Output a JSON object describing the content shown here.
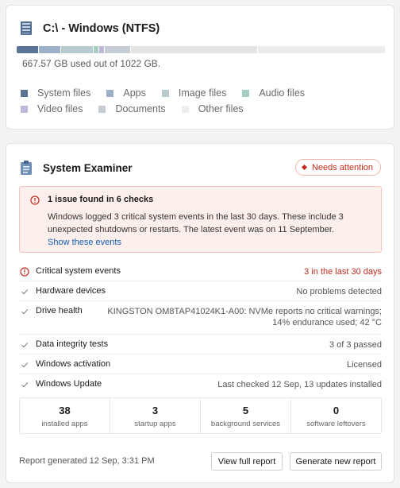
{
  "drive": {
    "title": "C:\\ - Windows (NTFS)",
    "usage_text": "667.57 GB used out of 1022 GB.",
    "used_fraction": 0.653,
    "segments": [
      {
        "name": "System files",
        "fraction": 0.06,
        "color": "#5b7396"
      },
      {
        "name": "Apps",
        "fraction": 0.06,
        "color": "#9cb0c9"
      },
      {
        "name": "Image files",
        "fraction": 0.09,
        "color": "#b7cad0"
      },
      {
        "name": "Audio files",
        "fraction": 0.015,
        "color": "#a5cfc1"
      },
      {
        "name": "Video files",
        "fraction": 0.015,
        "color": "#c0b8d9"
      },
      {
        "name": "Documents",
        "fraction": 0.07,
        "color": "#c6ccd4"
      },
      {
        "name": "Other files",
        "fraction": 0.345,
        "color": "#e4e4e4"
      }
    ],
    "legend": {
      "system": "System files",
      "apps": "Apps",
      "image": "Image files",
      "audio": "Audio files",
      "video": "Video files",
      "documents": "Documents",
      "other": "Other files"
    }
  },
  "examiner": {
    "title": "System Examiner",
    "badge": "Needs attention",
    "alert": {
      "title": "1 issue found in 6 checks",
      "body": "Windows logged 3 critical system events in the last 30 days. These include 3 unexpected shutdowns or restarts. The latest event was on 11 September.",
      "link": "Show these events"
    },
    "checks": [
      {
        "label": "Critical system events",
        "value": "3 in the last 30 days"
      },
      {
        "label": "Hardware devices",
        "value": "No problems detected"
      },
      {
        "label": "Drive health",
        "value": "KINGSTON OM8TAP41024K1-A00: NVMe reports no critical warnings; 14% endurance used; 42 °C"
      },
      {
        "label": "Data integrity tests",
        "value": "3 of 3 passed"
      },
      {
        "label": "Windows activation",
        "value": "Licensed"
      },
      {
        "label": "Windows Update",
        "value": "Last checked 12 Sep, 13 updates installed"
      }
    ],
    "stats": [
      {
        "num": "38",
        "label": "installed apps"
      },
      {
        "num": "3",
        "label": "startup apps"
      },
      {
        "num": "5",
        "label": "background services"
      },
      {
        "num": "0",
        "label": "software leftovers"
      }
    ],
    "footer": {
      "generated": "Report generated 12 Sep, 3:31 PM",
      "view_full": "View full report",
      "generate_new": "Generate new report"
    }
  },
  "colors": {
    "accent_link": "#0f5fb5",
    "warning": "#c42b1c"
  }
}
